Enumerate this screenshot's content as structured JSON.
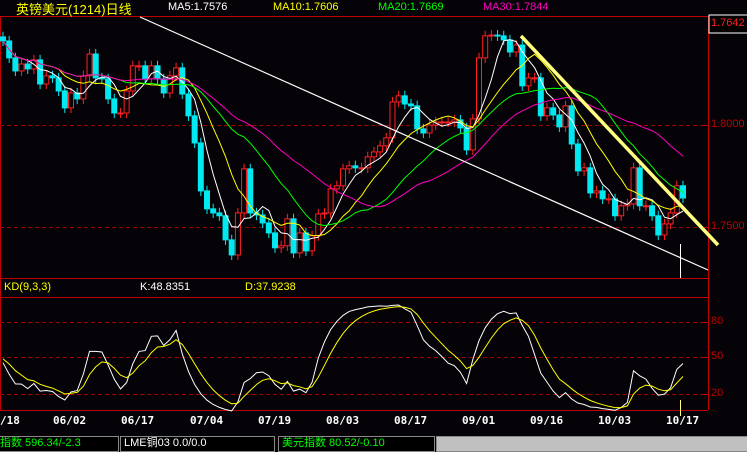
{
  "header": {
    "title": "英镑美元(1214)日线",
    "ma5": "MA5:1.7576",
    "ma10": "MA10:1.7606",
    "ma20": "MA20:1.7669",
    "ma30": "MA30:1.7844"
  },
  "price_axis": {
    "current_price": "1.7642",
    "ticks": [
      "1.8000",
      "1.7500"
    ]
  },
  "kd": {
    "label": "KD(9,3,3)",
    "k": "K:48.8351",
    "d": "D:37.9238",
    "ticks": [
      "80",
      "50",
      "20"
    ]
  },
  "dates": [
    "/18",
    "06/02",
    "06/17",
    "07/04",
    "07/19",
    "08/03",
    "08/17",
    "09/01",
    "09/16",
    "10/03",
    "10/17"
  ],
  "status_bar": {
    "index": "指数  596.34/-2.3",
    "lme": "LME铜03   0.0/0.0",
    "usd_index": "美元指数 80.52/-0.10"
  },
  "colors": {
    "up": "#ff2020",
    "down": "#00e8f0",
    "ma5": "#ffffff",
    "ma10": "#ffff00",
    "ma20": "#00ff00",
    "ma30": "#ff00c0",
    "axis": "#c00000"
  },
  "chart_data": {
    "type": "candlestick",
    "ylim": [
      1.735,
      1.853
    ],
    "close": [
      1.8412,
      1.8329,
      1.8265,
      1.8299,
      1.8275,
      1.8319,
      1.8201,
      1.8241,
      1.8231,
      1.8167,
      1.8084,
      1.8157,
      1.8128,
      1.8241,
      1.8348,
      1.8231,
      1.8226,
      1.8128,
      1.8059,
      1.8059,
      1.8167,
      1.829,
      1.829,
      1.8226,
      1.829,
      1.8226,
      1.8157,
      1.8241,
      1.828,
      1.8152,
      1.8045,
      1.7912,
      1.7677,
      1.7589,
      1.7569,
      1.7555,
      1.7437,
      1.7363,
      1.7569,
      1.7785,
      1.7569,
      1.7559,
      1.752,
      1.7471,
      1.7398,
      1.7408,
      1.754,
      1.7373,
      1.7471,
      1.7383,
      1.7457,
      1.7564,
      1.7569,
      1.7687,
      1.7702,
      1.7785,
      1.78,
      1.779,
      1.779,
      1.7844,
      1.7868,
      1.7898,
      1.7937,
      1.8113,
      1.8143,
      1.8103,
      1.8094,
      1.7981,
      1.7961,
      1.8,
      1.8015,
      1.8015,
      1.8015,
      1.8025,
      1.7986,
      1.7878,
      1.803,
      1.8329,
      1.8437,
      1.8441,
      1.8437,
      1.8417,
      1.8358,
      1.8392,
      1.8192,
      1.8231,
      1.8231,
      1.8045,
      1.8084,
      1.8049,
      1.7991,
      1.8094,
      1.7907,
      1.7775,
      1.779,
      1.7667,
      1.7677,
      1.7638,
      1.7638,
      1.7555,
      1.7604,
      1.7613,
      1.779,
      1.7604,
      1.7604,
      1.7555,
      1.7461,
      1.7515,
      1.7569,
      1.7702,
      1.7642
    ],
    "ma_periods": [
      5,
      10,
      20,
      30
    ],
    "kd_params": [
      9,
      3,
      3
    ],
    "kd_ylim": [
      0,
      100
    ]
  }
}
